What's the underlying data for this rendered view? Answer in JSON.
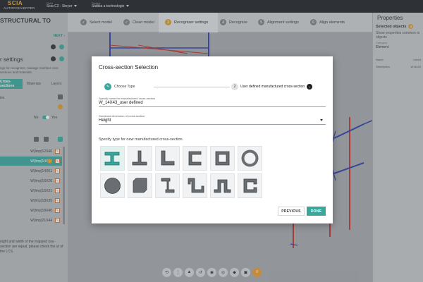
{
  "app": {
    "logo_line1": "SCIA",
    "logo_line2": "AUTOCONVERTER",
    "field1_label": "Field",
    "field1_value": "Scia C2 - Steyer",
    "field2_label": "Project",
    "field2_value": "Statika a technologie"
  },
  "workflow": {
    "steps": [
      {
        "label": "Select model",
        "icon": "check-icon"
      },
      {
        "label": "Clean model",
        "icon": "check-icon"
      },
      {
        "label": "Recognizer settings",
        "icon": "number-icon",
        "num": "3"
      },
      {
        "label": "Recognize",
        "icon": "number-icon",
        "num": "4"
      },
      {
        "label": "Alignment settings",
        "icon": "number-icon",
        "num": "5"
      },
      {
        "label": "Align elements",
        "icon": "number-icon",
        "num": "6"
      }
    ]
  },
  "left_panel": {
    "title": "STRUCTURAL TO",
    "next": "NEXT",
    "subtitle": "r settings",
    "description": "ngs for recognizer, manage member ross-sections and materials.",
    "tabs": [
      "Cross-sections",
      "Materials",
      "Layers"
    ],
    "row_label": "ies",
    "toggle_no": "No",
    "toggle_yes": "Yes",
    "items": [
      {
        "label": "W(Imp)12X40",
        "selected": false
      },
      {
        "label": "W(Imp)14X43",
        "selected": true,
        "badge": "2"
      },
      {
        "label": "W(Imp)14X61",
        "selected": false
      },
      {
        "label": "W(Imp)16X26",
        "selected": false
      },
      {
        "label": "W(Imp)16X31",
        "selected": false
      },
      {
        "label": "W(Imp)18X35",
        "selected": false
      },
      {
        "label": "W(Imp)18X40",
        "selected": false
      },
      {
        "label": "W(Imp)21X44",
        "selected": false
      }
    ],
    "note": "eight and width of the mapped oss-section are equal, please check the ut of the LCS."
  },
  "right_panel": {
    "title": "Properties",
    "selected_label": "Selected objects",
    "selected_count": "2",
    "description": "Show properties common to objects",
    "category_label": "Category",
    "category_value": "Element",
    "name_key": "Name",
    "name_val": "mixed",
    "desc_key": "Description",
    "desc_val": "W14x43"
  },
  "dialog": {
    "title": "Cross-section Selection",
    "step1_label": "Choose Type",
    "step2_num": "2",
    "step2_label": "User defined manufactured cross-section",
    "name_label": "Specify name for manufactured cross-section",
    "name_value": "W_14X43_user defined",
    "dim_label": "Dominant dimension of cross-section",
    "dim_value": "Height",
    "prompt": "Specify type for new manufactured cross-section.",
    "shapes": [
      "i-section",
      "angle-t",
      "angle-l",
      "channel",
      "rect-hollow",
      "circle-hollow",
      "circle-solid",
      "rect-solid",
      "z-section",
      "z-lipped",
      "omega",
      "c-lipped"
    ],
    "selected_shape": "i-section",
    "previous_label": "PREVIOUS",
    "done_label": "DONE"
  },
  "toolbar": {
    "icons": [
      "orbit-icon",
      "more-icon",
      "measure-icon",
      "rotate-icon",
      "camera-icon",
      "eye-icon",
      "layers-icon",
      "tag-icon",
      "filter-icon"
    ]
  },
  "colors": {
    "accent": "#3aa79d",
    "orange": "#d69b2e",
    "beam_red": "#c0312b",
    "beam_blue": "#2b3ea8"
  }
}
